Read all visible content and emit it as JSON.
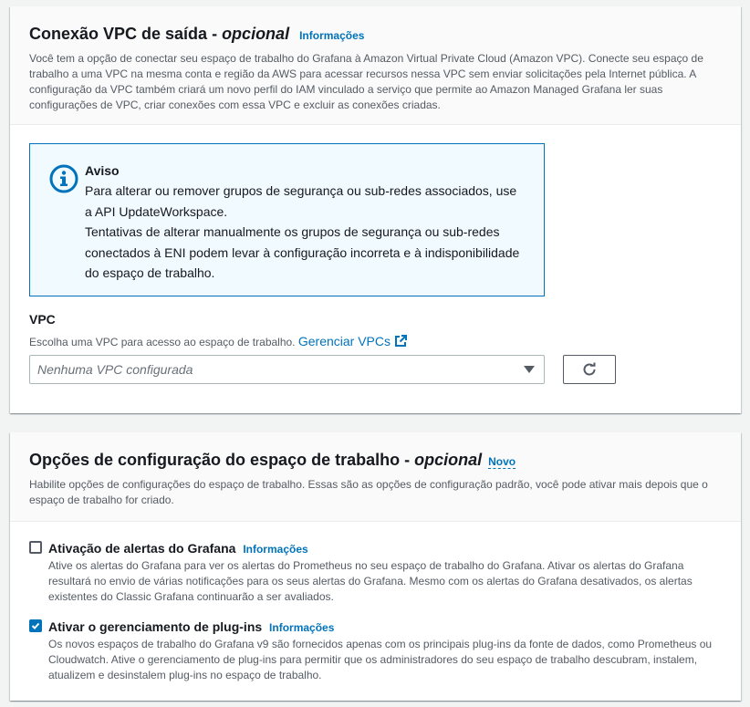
{
  "vpc_panel": {
    "title_main": "Conexão VPC de saída - ",
    "title_optional": "opcional",
    "info_link": "Informações",
    "description": "Você tem a opção de conectar seu espaço de trabalho do Grafana à Amazon Virtual Private Cloud (Amazon VPC). Conecte seu espaço de trabalho a uma VPC na mesma conta e região da AWS para acessar recursos nessa VPC sem enviar solicitações pela Internet pública. A configuração da VPC também criará um novo perfil do IAM vinculado a serviço que permite ao Amazon Managed Grafana ler suas configurações de VPC, criar conexões com essa VPC e excluir as conexões criadas.",
    "alert": {
      "icon": "info-circle-icon",
      "title": "Aviso",
      "line1": "Para alterar ou remover grupos de segurança ou sub-redes associados, use a API UpdateWorkspace.",
      "line2": "Tentativas de alterar manualmente os grupos de segurança ou sub-redes conectados à ENI podem levar à configuração incorreta e à indisponibilidade do espaço de trabalho."
    },
    "vpc_field": {
      "label": "VPC",
      "description": "Escolha uma VPC para acesso ao espaço de trabalho.",
      "manage_link": "Gerenciar VPCs",
      "select_placeholder": "Nenhuma VPC configurada"
    }
  },
  "config_panel": {
    "title_main": "Opções de configuração do espaço de trabalho - ",
    "title_optional": "opcional",
    "new_link": "Novo",
    "description": "Habilite opções de configurações do espaço de trabalho. Essas são as opções de configuração padrão, você pode ativar mais depois que o espaço de trabalho for criado.",
    "options": [
      {
        "title": "Ativação de alertas do Grafana",
        "info_link": "Informações",
        "checked": false,
        "description": "Ative os alertas do Grafana para ver os alertas do Prometheus no seu espaço de trabalho do Grafana. Ativar os alertas do Grafana resultará no envio de várias notificações para os seus alertas do Grafana. Mesmo com os alertas do Grafana desativados, os alertas existentes do Classic Grafana continuarão a ser avaliados."
      },
      {
        "title": "Ativar o gerenciamento de plug-ins",
        "info_link": "Informações",
        "checked": true,
        "description": "Os novos espaços de trabalho do Grafana v9 são fornecidos apenas com os principais plug-ins da fonte de dados, como Prometheus ou Cloudwatch. Ative o gerenciamento de plug-ins para permitir que os administradores do seu espaço de trabalho descubram, instalem, atualizem e desinstalem plug-ins no espaço de trabalho."
      }
    ]
  },
  "colors": {
    "link": "#0073bb",
    "alert_bg": "#f1faff",
    "panel_header_bg": "#fafafa",
    "page_bg": "#f2f3f3"
  }
}
